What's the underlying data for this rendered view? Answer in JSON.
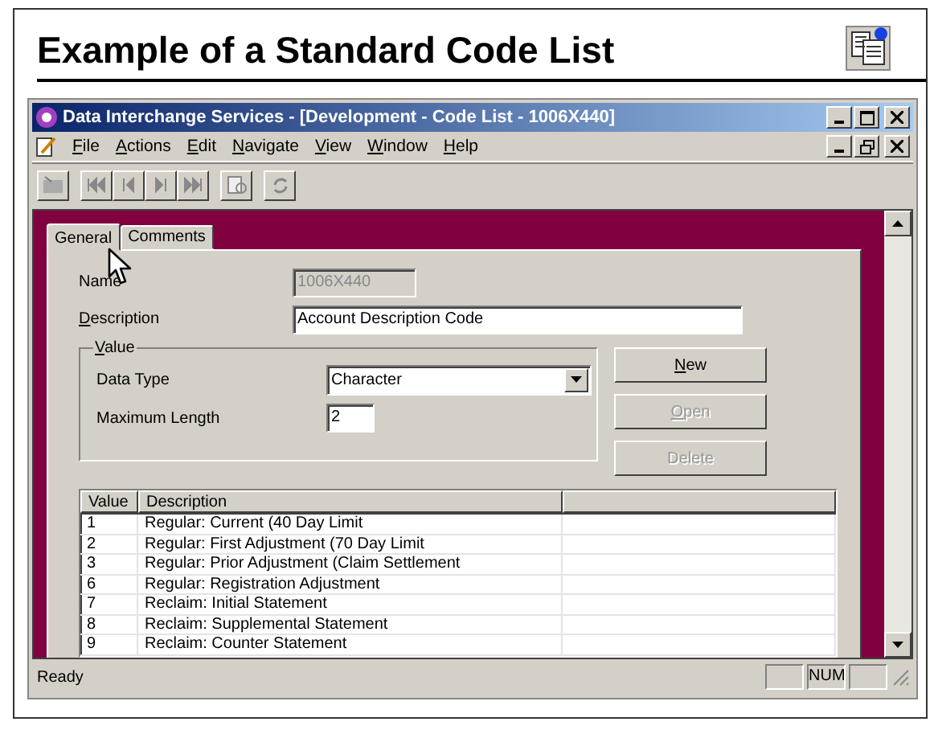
{
  "slide": {
    "title": "Example of a Standard Code List"
  },
  "window": {
    "title": "Data Interchange Services - [Development - Code List - 1006X440]"
  },
  "menu": [
    {
      "label": "File"
    },
    {
      "label": "Actions"
    },
    {
      "label": "Edit"
    },
    {
      "label": "Navigate"
    },
    {
      "label": "View"
    },
    {
      "label": "Window"
    },
    {
      "label": "Help"
    }
  ],
  "tabs": [
    {
      "label": "General",
      "selected": true
    },
    {
      "label": "Comments",
      "selected": false
    }
  ],
  "fields": [
    {
      "label": "Name",
      "value": "1006X440",
      "disabled": true
    },
    {
      "label": "Description",
      "value": "Account Description Code",
      "disabled": false
    }
  ],
  "value_group": {
    "legend": "Value",
    "data_type": {
      "label": "Data Type",
      "value": "Character"
    },
    "max_length": {
      "label": "Maximum Length",
      "value": "2"
    }
  },
  "buttons": [
    {
      "label": "New",
      "disabled": false
    },
    {
      "label": "Open",
      "disabled": true
    },
    {
      "label": "Delete",
      "disabled": true
    }
  ],
  "table": {
    "columns": [
      "Value",
      "Description"
    ],
    "rows": [
      [
        "1",
        "Regular: Current (40 Day Limit"
      ],
      [
        "2",
        "Regular: First Adjustment (70 Day Limit"
      ],
      [
        "3",
        "Regular: Prior Adjustment (Claim Settlement"
      ],
      [
        "6",
        "Regular: Registration Adjustment"
      ],
      [
        "7",
        "Reclaim: Initial Statement"
      ],
      [
        "8",
        "Reclaim: Supplemental Statement"
      ],
      [
        "9",
        "Reclaim: Counter Statement"
      ]
    ]
  },
  "status_bar": {
    "text": "Ready",
    "num_indicator": "NUM"
  }
}
